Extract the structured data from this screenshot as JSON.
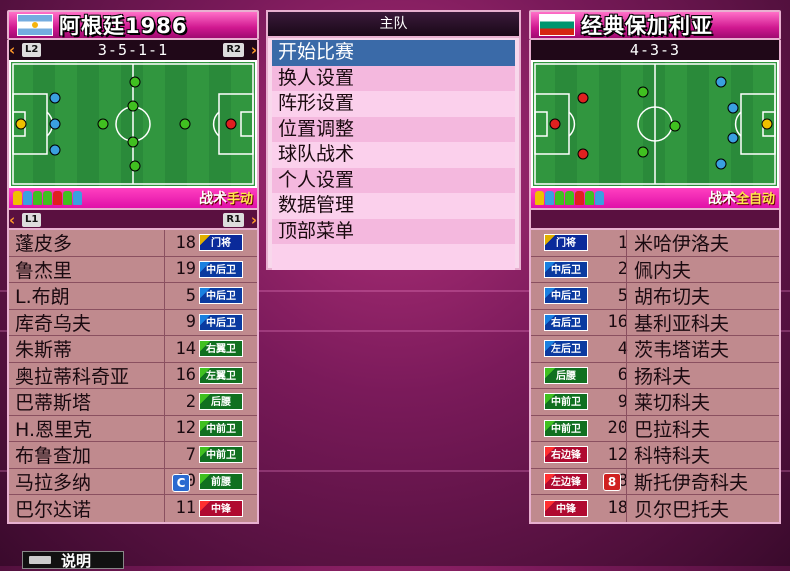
{
  "home": {
    "name": "阿根廷1986",
    "flag": "argentina-flag",
    "formation": "3-5-1-1",
    "tag_left": "L2",
    "tag_right": "R2",
    "tactic_label": "战术",
    "tactic_mode": "手动",
    "sub_tag_left": "L1",
    "sub_tag_right": "R1",
    "players": [
      {
        "name": "蓬皮多",
        "num": "18",
        "pos": "门将",
        "pos_type": "gk"
      },
      {
        "name": "鲁杰里",
        "num": "19",
        "pos": "中后卫",
        "pos_type": "df"
      },
      {
        "name": "L.布朗",
        "num": "5",
        "pos": "中后卫",
        "pos_type": "df"
      },
      {
        "name": "库奇乌夫",
        "num": "9",
        "pos": "中后卫",
        "pos_type": "df"
      },
      {
        "name": "朱斯蒂",
        "num": "14",
        "pos": "右翼卫",
        "pos_type": "mf"
      },
      {
        "name": "奥拉蒂科奇亚",
        "num": "16",
        "pos": "左翼卫",
        "pos_type": "mf"
      },
      {
        "name": "巴蒂斯塔",
        "num": "2",
        "pos": "后腰",
        "pos_type": "mf"
      },
      {
        "name": "H.恩里克",
        "num": "12",
        "pos": "中前卫",
        "pos_type": "mf"
      },
      {
        "name": "布鲁查加",
        "num": "7",
        "pos": "中前卫",
        "pos_type": "mf"
      },
      {
        "name": "马拉多纳",
        "num": "10",
        "pos": "前腰",
        "pos_type": "mf",
        "badge": "C"
      },
      {
        "name": "巴尔达诺",
        "num": "11",
        "pos": "中锋",
        "pos_type": "fw"
      }
    ]
  },
  "away": {
    "name": "经典保加利亚",
    "flag": "bulgaria-flag",
    "formation": "4-3-3",
    "tactic_label": "战术",
    "tactic_mode": "全自动",
    "players": [
      {
        "name": "米哈伊洛夫",
        "num": "1",
        "pos": "门将",
        "pos_type": "gk"
      },
      {
        "name": "佩内夫",
        "num": "2",
        "pos": "中后卫",
        "pos_type": "df"
      },
      {
        "name": "胡布切夫",
        "num": "5",
        "pos": "中后卫",
        "pos_type": "df"
      },
      {
        "name": "基利亚科夫",
        "num": "16",
        "pos": "右后卫",
        "pos_type": "df"
      },
      {
        "name": "茨韦塔诺夫",
        "num": "4",
        "pos": "左后卫",
        "pos_type": "df"
      },
      {
        "name": "扬科夫",
        "num": "6",
        "pos": "后腰",
        "pos_type": "mf"
      },
      {
        "name": "莱切科夫",
        "num": "9",
        "pos": "中前卫",
        "pos_type": "mf"
      },
      {
        "name": "巴拉科夫",
        "num": "20",
        "pos": "中前卫",
        "pos_type": "mf"
      },
      {
        "name": "科特科夫",
        "num": "12",
        "pos": "右边锋",
        "pos_type": "fw"
      },
      {
        "name": "斯托伊奇科夫",
        "num": "8",
        "pos": "左边锋",
        "pos_type": "fw",
        "badge": "8"
      },
      {
        "name": "贝尔巴托夫",
        "num": "18",
        "pos": "中锋",
        "pos_type": "fw"
      }
    ]
  },
  "menu": {
    "title": "主队",
    "items": [
      "开始比赛",
      "换人设置",
      "阵形设置",
      "位置调整",
      "球队战术",
      "个人设置",
      "数据管理",
      "顶部菜单",
      ""
    ],
    "selected": 0
  },
  "footer": {
    "help_label": "说明"
  },
  "colors": {
    "accent": "#e010a8",
    "pitch": "#2a8a3a",
    "home_player": "#3aa0e0",
    "away_player": "#e02020",
    "selected_menu": "#3a6aa8"
  }
}
